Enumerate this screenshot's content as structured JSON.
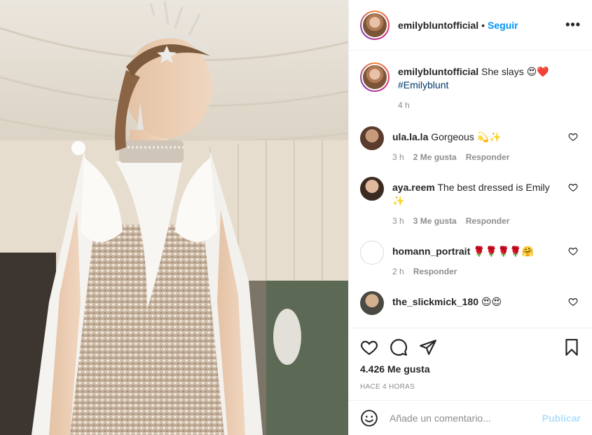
{
  "post": {
    "username": "emilybluntofficial",
    "dot": "•",
    "follow_label": "Seguir",
    "more_label": "•••"
  },
  "caption": {
    "username": "emilybluntofficial",
    "text": "She slays 😍❤️",
    "hashtag": "#Emilyblunt",
    "time": "4 h"
  },
  "comments": [
    {
      "username": "ula.la.la",
      "text": "Gorgeous 💫✨",
      "time": "3 h",
      "likes": "2 Me gusta",
      "reply": "Responder"
    },
    {
      "username": "aya.reem",
      "text": "The best dressed is Emily ✨",
      "time": "3 h",
      "likes": "3 Me gusta",
      "reply": "Responder"
    },
    {
      "username": "homann_portrait",
      "text": "🌹🌹🌹🌹🤗",
      "time": "2 h",
      "likes": "",
      "reply": "Responder"
    },
    {
      "username": "the_slickmick_180",
      "text": "😍😍",
      "time": "",
      "likes": "",
      "reply": ""
    }
  ],
  "actions": {
    "likes_count": "4.426 Me gusta",
    "posted_ago": "HACE 4 HORAS"
  },
  "comment_box": {
    "placeholder": "Añade un comentario...",
    "publish_label": "Publicar"
  },
  "colors": {
    "accent": "#0095f6",
    "publish_disabled": "#b2dffc",
    "muted": "#8e8e8e",
    "hashtag": "#00376b"
  }
}
